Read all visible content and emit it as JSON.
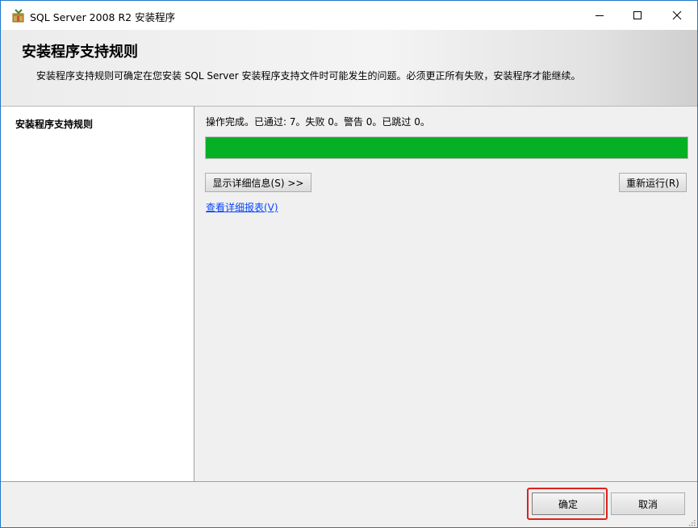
{
  "window": {
    "title": "SQL Server 2008 R2 安装程序",
    "controls": {
      "minimize_icon": "minimize-icon",
      "maximize_icon": "maximize-icon",
      "close_icon": "close-icon"
    }
  },
  "header": {
    "title": "安装程序支持规则",
    "description": "安装程序支持规则可确定在您安装 SQL Server 安装程序支持文件时可能发生的问题。必须更正所有失败，安装程序才能继续。"
  },
  "sidebar": {
    "items": [
      {
        "label": "安装程序支持规则",
        "selected": true
      }
    ]
  },
  "main": {
    "status_text": "操作完成。已通过: 7。失败 0。警告 0。已跳过 0。",
    "progress": {
      "percent": 100,
      "color": "#06b025"
    },
    "show_details_button": "显示详细信息(S) >>",
    "rerun_button": "重新运行(R)",
    "report_link": "查看详细报表(V)"
  },
  "footer": {
    "ok_button": "确定",
    "cancel_button": "取消",
    "highlight_color": "#e0201e"
  }
}
